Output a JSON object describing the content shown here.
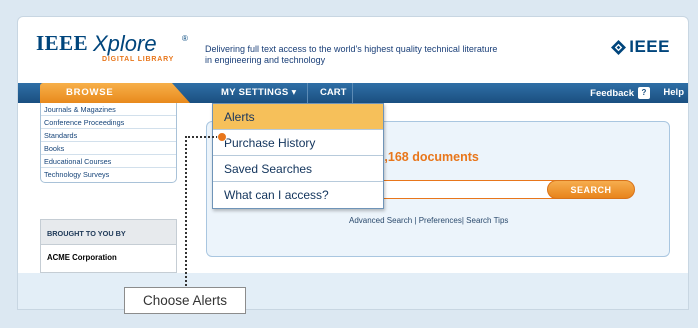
{
  "header": {
    "logo_ieee": "IEEE",
    "logo_xplore": "Xplore",
    "logo_reg": "®",
    "logo_sub": "DIGITAL LIBRARY",
    "tagline": "Delivering full text access to the world's highest quality technical literature in engineering and technology",
    "ieee_brand": "IEEE"
  },
  "nav": {
    "browse": "BROWSE",
    "my_settings": "MY SETTINGS ▾",
    "cart": "CART",
    "feedback": "Feedback",
    "feedback_icon": "?",
    "help": "Help"
  },
  "browse_list": [
    "Journals & Magazines",
    "Conference Proceedings",
    "Standards",
    "Books",
    "Educational Courses",
    "Technology Surveys"
  ],
  "brought_by": {
    "heading": "BROUGHT TO YOU BY",
    "org": "ACME Corporation"
  },
  "search": {
    "headline": "h 2,458,168 documents",
    "input_value": "",
    "button": "SEARCH",
    "link_advanced": "Advanced Search",
    "separator": "|",
    "link_preferences": "Preferences",
    "link_tips": "Search Tips"
  },
  "dropdown": {
    "items": [
      "Alerts",
      "Purchase History",
      "Saved Searches",
      "What can I access?"
    ],
    "active_index": 0
  },
  "callout": {
    "text": "Choose Alerts"
  },
  "colors": {
    "brand_blue": "#00457c",
    "accent_orange": "#e8761b",
    "nav_blue": "#1a4f80",
    "highlight": "#f6c05a"
  },
  "icons": {
    "ieee_diamond": "ieee-diamond-icon",
    "help_question": "question-icon",
    "callout_marker": "callout-dot-icon"
  }
}
